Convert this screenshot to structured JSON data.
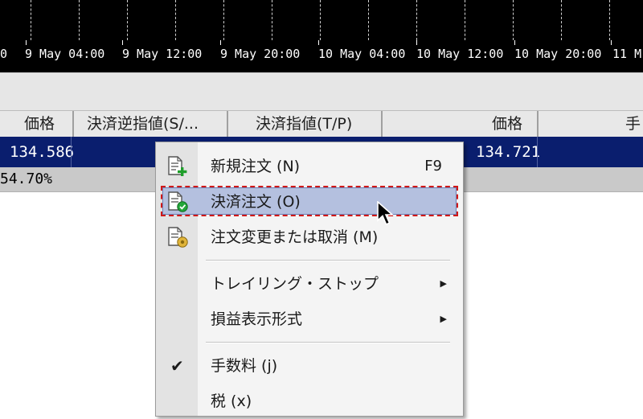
{
  "time_axis": {
    "labels": [
      "0",
      "9 May 04:00",
      "9 May 12:00",
      "9 May 20:00",
      "10 May 04:00",
      "10 May 12:00",
      "10 May 20:00",
      "11 M"
    ]
  },
  "table": {
    "headers": [
      "価格",
      "決済逆指値(S/...",
      "決済指値(T/P)",
      "価格",
      "手"
    ],
    "row": {
      "price_open": "134.586",
      "price_current": "134.721"
    },
    "summary": "54.70%"
  },
  "menu": {
    "items": [
      {
        "label": "新規注文 (N)",
        "shortcut": "F9",
        "icon": "new-order-icon"
      },
      {
        "label": "決済注文 (O)",
        "icon": "close-order-icon",
        "highlighted": true
      },
      {
        "label": "注文変更または取消 (M)",
        "icon": "modify-order-icon"
      },
      {
        "label": "トレイリング・ストップ",
        "submenu": true
      },
      {
        "label": "損益表示形式",
        "submenu": true
      },
      {
        "label": "手数料 (j)",
        "checked": true
      },
      {
        "label": "税 (x)"
      }
    ]
  },
  "colors": {
    "selected_row": "#0a1e6e",
    "highlight": "#b4c0df",
    "focus_outline": "#d01818"
  }
}
